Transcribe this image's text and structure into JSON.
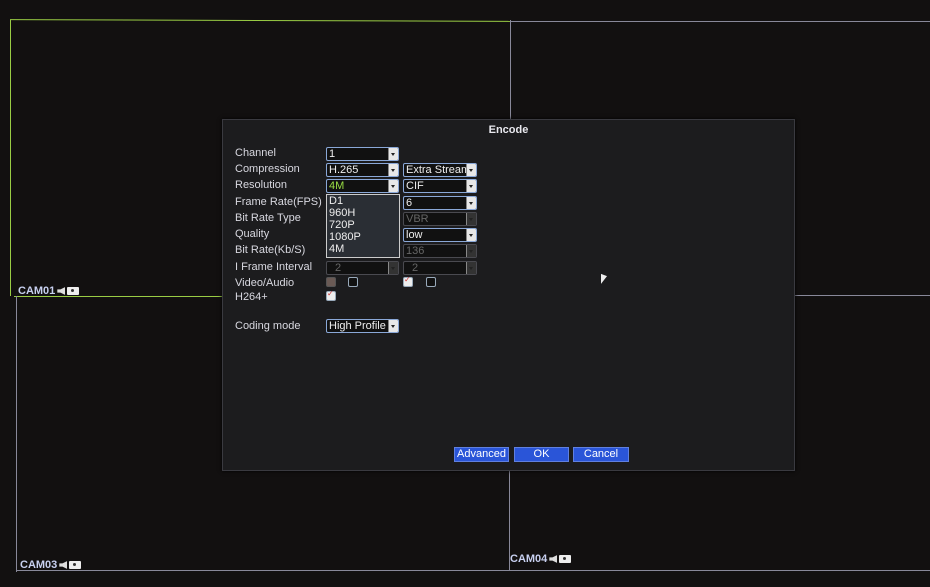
{
  "cameras": [
    "CAM01",
    "CAM03",
    "CAM04"
  ],
  "dialog": {
    "title": "Encode",
    "labels": [
      "Channel",
      "Compression",
      "Resolution",
      "Frame Rate(FPS)",
      "Bit Rate Type",
      "Quality",
      "Bit Rate(Kb/S)",
      "I Frame Interval",
      "Video/Audio",
      "H264+",
      "Coding mode"
    ],
    "main": {
      "channel": "1",
      "compression": "H.265",
      "resolution": "4M",
      "iframe": "2",
      "coding_mode": "High Profile"
    },
    "extra": {
      "stream": "Extra Stream",
      "resolution": "CIF",
      "frame_rate": "6",
      "bit_rate_type": "VBR",
      "quality": "low",
      "bit_rate": "136",
      "iframe": "2"
    },
    "resolution_options": [
      "D1",
      "960H",
      "720P",
      "1080P",
      "4M"
    ],
    "buttons": {
      "advanced": "Advanced",
      "ok": "OK",
      "cancel": "Cancel"
    }
  }
}
